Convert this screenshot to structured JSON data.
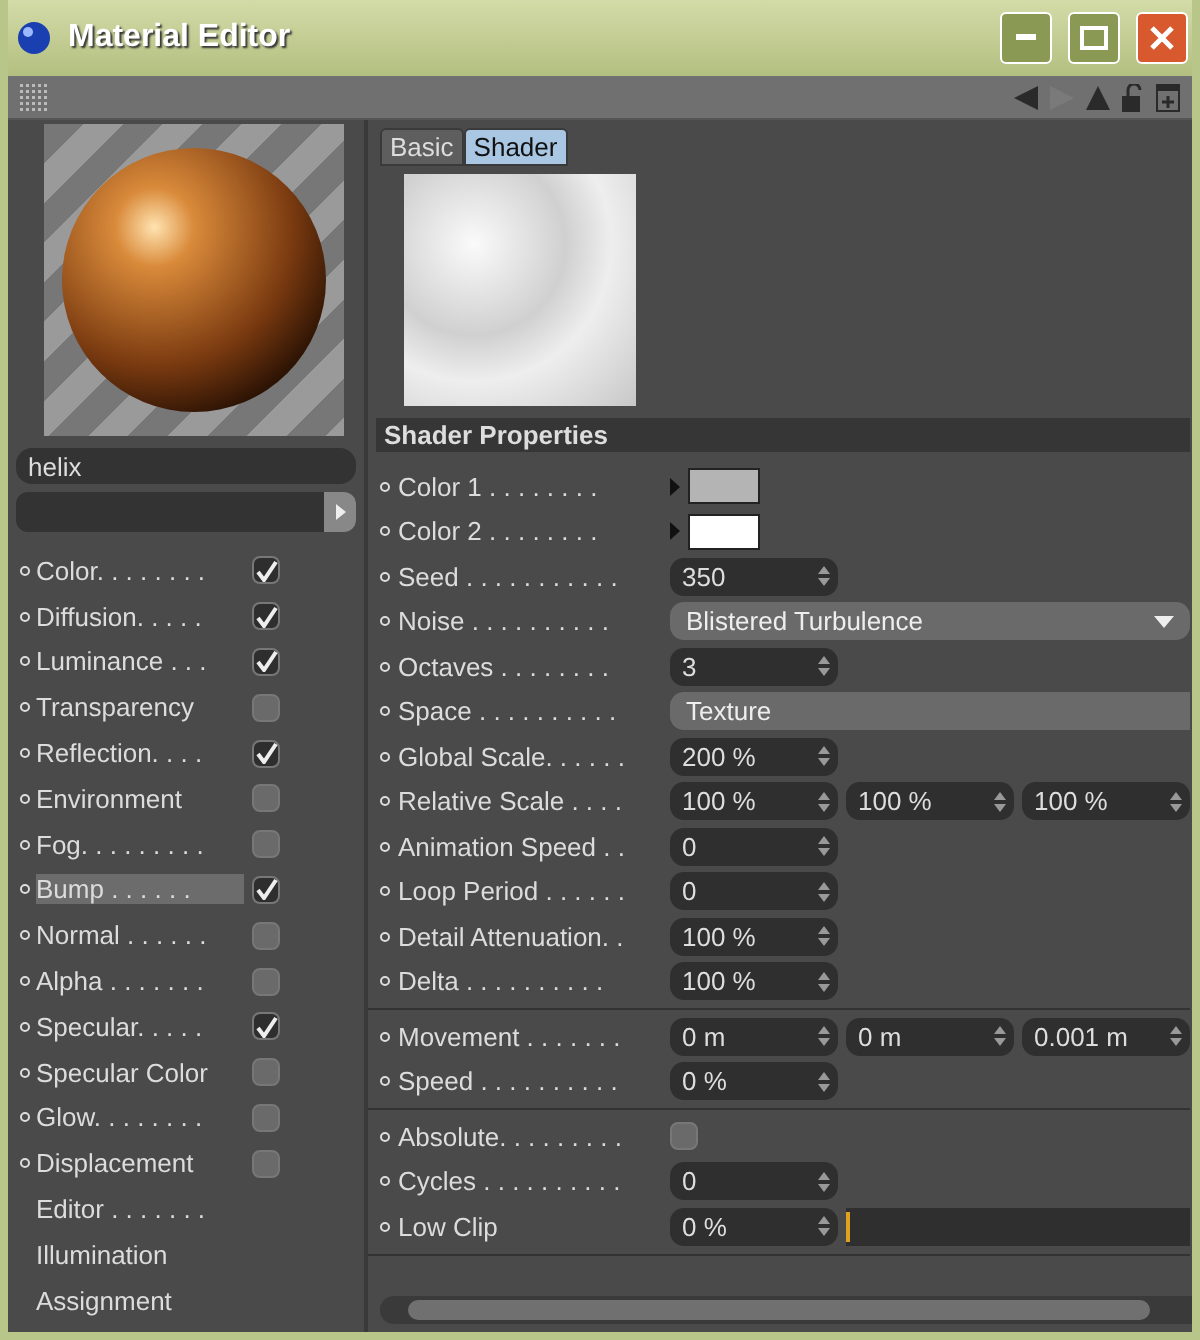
{
  "window": {
    "title": "Material Editor"
  },
  "material": {
    "name": "helix"
  },
  "channels": [
    {
      "label": "Color. . . . . . . .",
      "kind": "toggle",
      "checked": true,
      "selected": false
    },
    {
      "label": "Diffusion. . . . .",
      "kind": "toggle",
      "checked": true,
      "selected": false
    },
    {
      "label": "Luminance . . .",
      "kind": "toggle",
      "checked": true,
      "selected": false
    },
    {
      "label": "Transparency",
      "kind": "toggle",
      "checked": false,
      "selected": false
    },
    {
      "label": "Reflection. . . .",
      "kind": "toggle",
      "checked": true,
      "selected": false
    },
    {
      "label": "Environment",
      "kind": "toggle",
      "checked": false,
      "selected": false
    },
    {
      "label": "Fog. . . . . . . . .",
      "kind": "toggle",
      "checked": false,
      "selected": false
    },
    {
      "label": "Bump . . . . . .",
      "kind": "toggle",
      "checked": true,
      "selected": true
    },
    {
      "label": "Normal . . . . . .",
      "kind": "toggle",
      "checked": false,
      "selected": false
    },
    {
      "label": "Alpha . . . . . . .",
      "kind": "toggle",
      "checked": false,
      "selected": false
    },
    {
      "label": "Specular. . . . .",
      "kind": "toggle",
      "checked": true,
      "selected": false
    },
    {
      "label": "Specular Color",
      "kind": "toggle",
      "checked": false,
      "selected": false
    },
    {
      "label": "Glow. . . . . . . .",
      "kind": "toggle",
      "checked": false,
      "selected": false
    },
    {
      "label": "Displacement",
      "kind": "toggle",
      "checked": false,
      "selected": false
    },
    {
      "label": "Editor . . . . . . .",
      "kind": "page",
      "selected": false
    },
    {
      "label": "Illumination",
      "kind": "page",
      "selected": false
    },
    {
      "label": "Assignment",
      "kind": "page",
      "selected": false
    }
  ],
  "tabs": [
    {
      "label": "Basic",
      "selected": false
    },
    {
      "label": "Shader",
      "selected": true
    }
  ],
  "section_title": "Shader Properties",
  "groups": [
    {
      "rows": [
        {
          "label": "Color 1 . . . . . . . .",
          "kind": "color",
          "color": "#b4b4b4"
        },
        {
          "label": "Color 2 . . . . . . . .",
          "kind": "color",
          "color": "#ffffff"
        },
        {
          "label": "Seed . . . . . . . . . . .",
          "kind": "number",
          "values": [
            "350"
          ]
        },
        {
          "label": "Noise . . . . . . . . . .",
          "kind": "dropdown",
          "value": "Blistered Turbulence"
        },
        {
          "label": "Octaves . . . . . . . .",
          "kind": "number",
          "values": [
            "3"
          ]
        },
        {
          "label": "Space . . . . . . . . . .",
          "kind": "button",
          "value": "Texture"
        },
        {
          "label": "Global Scale. . . . . .",
          "kind": "number",
          "values": [
            "200 %"
          ]
        },
        {
          "label": "Relative Scale . . . .",
          "kind": "number",
          "values": [
            "100 %",
            "100 %",
            "100 %"
          ]
        },
        {
          "label": "Animation Speed . .",
          "kind": "number",
          "values": [
            "0"
          ]
        },
        {
          "label": "Loop Period . . . . . .",
          "kind": "number",
          "values": [
            "0"
          ]
        },
        {
          "label": "Detail Attenuation. .",
          "kind": "number",
          "values": [
            "100 %"
          ]
        },
        {
          "label": "Delta . . . . . . . . . .",
          "kind": "number",
          "values": [
            "100 %"
          ]
        }
      ]
    },
    {
      "rows": [
        {
          "label": "Movement . . . . . . .",
          "kind": "number",
          "values": [
            "0 m",
            "0 m",
            "0.001 m"
          ]
        },
        {
          "label": "Speed . . . . . . . . . .",
          "kind": "number",
          "values": [
            "0 %"
          ]
        }
      ]
    },
    {
      "rows": [
        {
          "label": "Absolute. . . . . . . . .",
          "kind": "checkbox",
          "checked": false
        },
        {
          "label": "Cycles . . . . . . . . . .",
          "kind": "number",
          "values": [
            "0"
          ]
        },
        {
          "label": "Low Clip",
          "kind": "slider",
          "values": [
            "0 %"
          ],
          "level": 0
        }
      ]
    }
  ]
}
